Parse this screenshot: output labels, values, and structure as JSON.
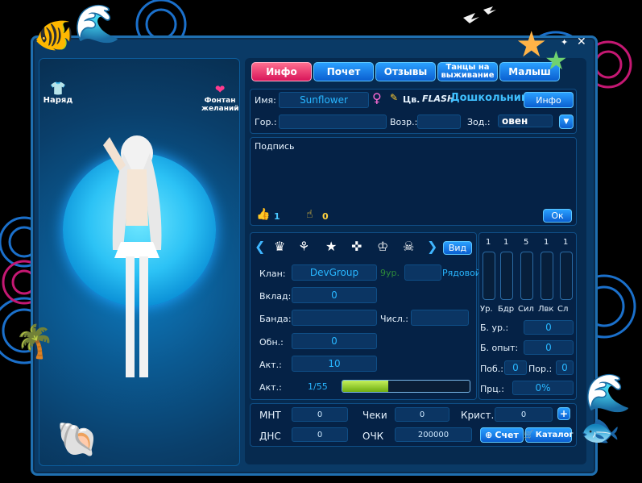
{
  "tabs": [
    {
      "label": "Инфо",
      "active": true
    },
    {
      "label": "Почет"
    },
    {
      "label": "Отзывы"
    },
    {
      "label": "Танцы на выживание"
    },
    {
      "label": "Малыш"
    }
  ],
  "left": {
    "outfit_label": "Наряд",
    "fountain_label": "Фонтан желаний"
  },
  "profile": {
    "name_label": "Имя:",
    "name": "Sunflower",
    "color_label": "Цв.",
    "flash_label": "FLASH",
    "rank": "Дошкольник",
    "info_button": "Инфо",
    "city_label": "Гор.:",
    "city": "",
    "age_label": "Возр.:",
    "age": "",
    "zodiac_label": "Зод.:",
    "zodiac": "овен"
  },
  "signature": {
    "label": "Подпись",
    "likes": "1",
    "dislikes": "0",
    "ok_button": "Ок"
  },
  "clan": {
    "view_button": "Вид",
    "clan_label": "Клан:",
    "clan": "DevGroup",
    "clan_level": "9ур.",
    "clan_rank": "Рядовой",
    "deposit_label": "Вклад:",
    "deposit": "0",
    "gang_label": "Банда:",
    "gang": "",
    "members_label": "Числ.:",
    "members": "",
    "update_label": "Обн.:",
    "update": "0",
    "act_label": "Акт.:",
    "act": "10",
    "act2_label": "Акт.:",
    "act2": "1/55",
    "act2_fraction": 0.36
  },
  "stats": {
    "values": [
      "1",
      "1",
      "5",
      "1",
      "1"
    ],
    "labels": [
      "Ур.",
      "Бдр",
      "Сил",
      "Лвк",
      "Сл"
    ],
    "b_level_label": "Б. ур.:",
    "b_level": "0",
    "b_exp_label": "Б. опыт:",
    "b_exp": "0",
    "wins_label": "Поб.:",
    "wins": "0",
    "losses_label": "Пор.:",
    "losses": "0",
    "pct_label": "Прц.:",
    "pct": "0%"
  },
  "currency": {
    "mnt_label": "МНТ",
    "mnt": "0",
    "checks_label": "Чеки",
    "checks": "0",
    "crystals_label": "Крист.:",
    "crystals": "0",
    "dns_label": "ДНС",
    "dns": "0",
    "och_label": "ОЧК",
    "och": "200000",
    "account_button": "Счет",
    "catalog_button": "Каталог"
  },
  "colors": {
    "accent": "#2aa0ff",
    "active_tab": "#d8155a",
    "bar_fill": "#8fd21a"
  }
}
